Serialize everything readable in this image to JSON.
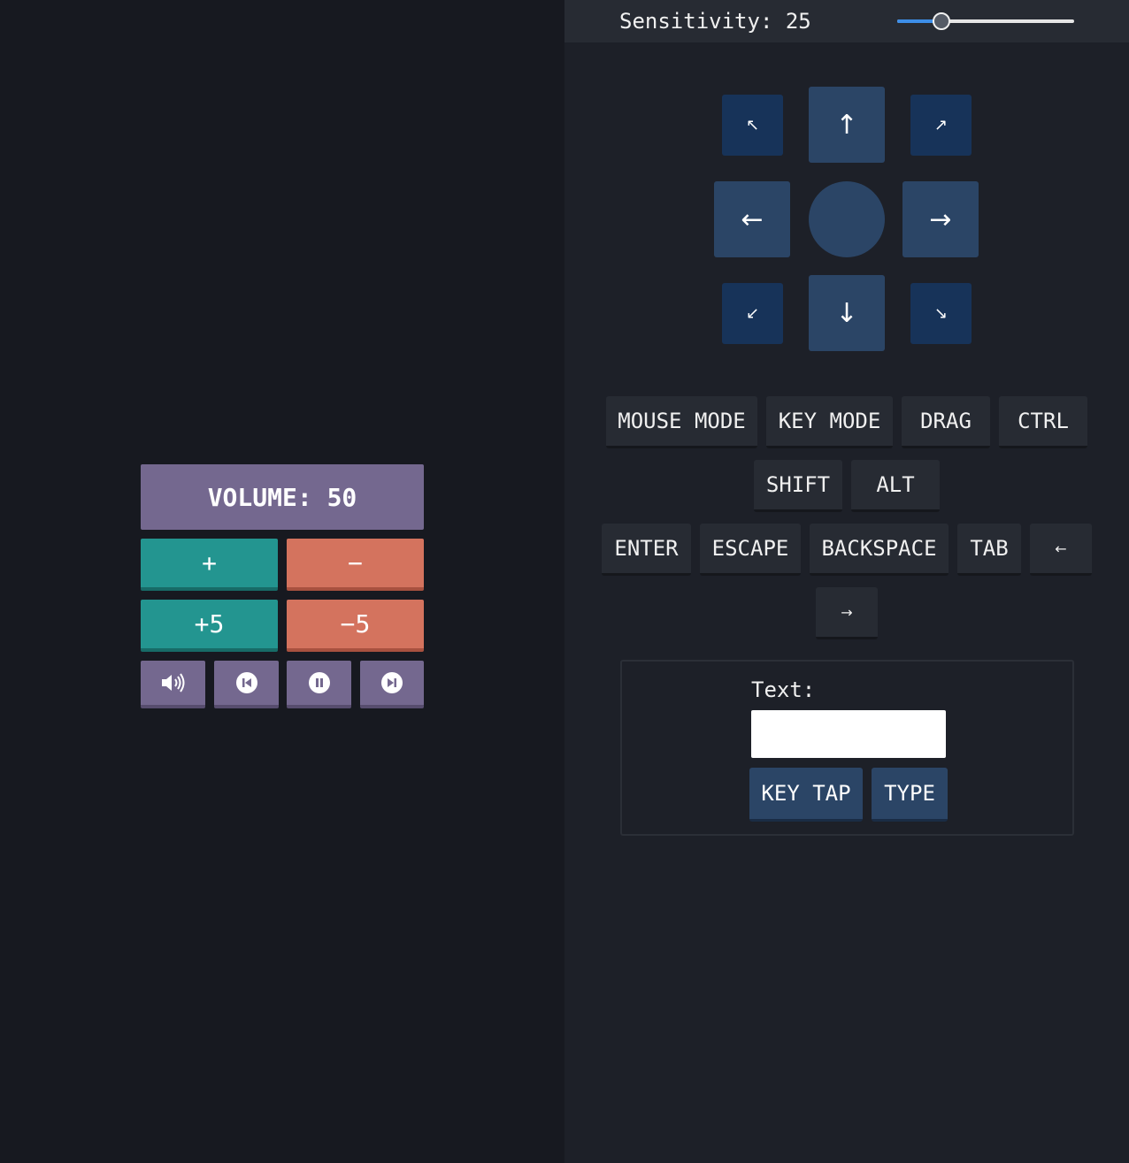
{
  "volume": {
    "display_label": "VOLUME: 50",
    "plus_label": "+",
    "minus_label": "−",
    "plus5_label": "+5",
    "minus5_label": "−5",
    "colors": {
      "panel": "#74688f",
      "increase": "#239590",
      "decrease": "#d4735e"
    },
    "media_icons": [
      "volume-icon",
      "previous-track-icon",
      "pause-icon",
      "next-track-icon"
    ]
  },
  "sensitivity": {
    "label": "Sensitivity: 25",
    "value": 25,
    "min": 0,
    "max": 100,
    "accent": "#3d8ee8"
  },
  "dpad": {
    "up": "↑",
    "down": "↓",
    "left": "←",
    "right": "→",
    "up_left": "↖",
    "up_right": "↗",
    "down_left": "↙",
    "down_right": "↘"
  },
  "keys": {
    "mouse_mode": "MOUSE MODE",
    "key_mode": "KEY MODE",
    "drag": "DRAG",
    "ctrl": "CTRL",
    "shift": "SHIFT",
    "alt": "ALT",
    "enter": "ENTER",
    "escape": "ESCAPE",
    "backspace": "BACKSPACE",
    "tab": "TAB",
    "arrow_left": "←",
    "arrow_right": "→"
  },
  "text_panel": {
    "label": "Text:",
    "input_value": "",
    "key_tap_label": "KEY TAP",
    "type_label": "TYPE"
  }
}
